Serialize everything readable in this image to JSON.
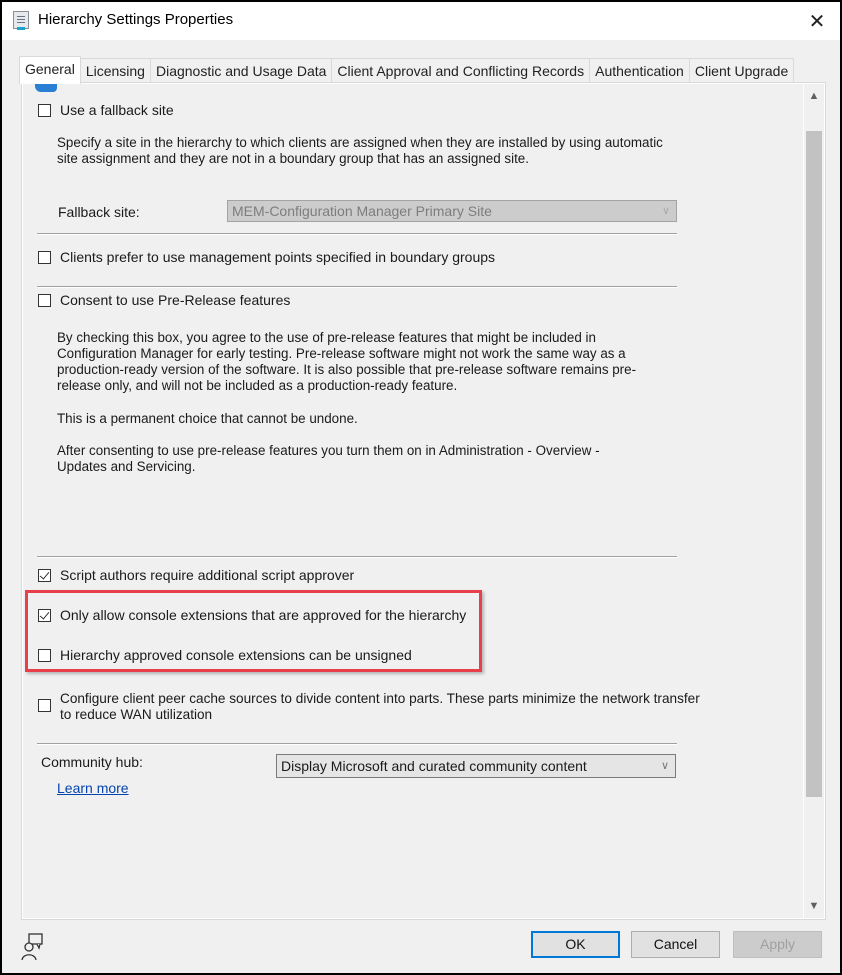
{
  "window": {
    "title": "Hierarchy Settings Properties",
    "icon": "properties-sheet-icon",
    "close_icon": "close-icon"
  },
  "tabs": [
    {
      "label": "General",
      "active": true
    },
    {
      "label": "Licensing",
      "active": false
    },
    {
      "label": "Diagnostic and Usage Data",
      "active": false
    },
    {
      "label": "Client Approval and Conflicting Records",
      "active": false
    },
    {
      "label": "Authentication",
      "active": false
    },
    {
      "label": "Client Upgrade",
      "active": false
    }
  ],
  "general": {
    "fallback": {
      "checkbox_label": "Use a fallback site",
      "checked": false,
      "description": "Specify a site in the hierarchy to which clients are assigned when they are installed by using automatic site assignment and they are not in a boundary group that has an assigned site.",
      "site_label": "Fallback site:",
      "site_value": "MEM-Configuration Manager Primary Site"
    },
    "prefer_mp": {
      "label": "Clients prefer to use management points specified in boundary groups",
      "checked": false
    },
    "prerelease": {
      "label": "Consent to use Pre-Release features",
      "checked": false,
      "description_1": "By checking this box, you agree to the use of pre-release features that might be included in Configuration Manager for early testing. Pre-release software might not work the same way as a production-ready version of the software. It is also possible that pre-release software remains pre-release only, and will not be included as a production-ready feature.",
      "description_2": "This is a permanent choice that cannot be undone.",
      "description_3": "After consenting to use pre-release features you turn them on in Administration - Overview - Updates and Servicing."
    },
    "script_approver": {
      "label": "Script authors require additional script approver",
      "checked": true
    },
    "console_ext_approved": {
      "label": "Only allow console extensions that are approved for the hierarchy",
      "checked": true
    },
    "console_ext_unsigned": {
      "label": "Hierarchy approved console extensions can be unsigned",
      "checked": false
    },
    "peer_cache": {
      "label": "Configure client peer cache sources to divide content into parts. These parts minimize the network transfer to reduce WAN utilization",
      "checked": false
    },
    "community_hub": {
      "label": "Community hub:",
      "value": "Display Microsoft and curated community content",
      "learn_more": "Learn more"
    }
  },
  "highlight_color": "#e8404a",
  "footer": {
    "help_icon": "user-feedback-icon",
    "ok": "OK",
    "cancel": "Cancel",
    "apply": "Apply"
  }
}
